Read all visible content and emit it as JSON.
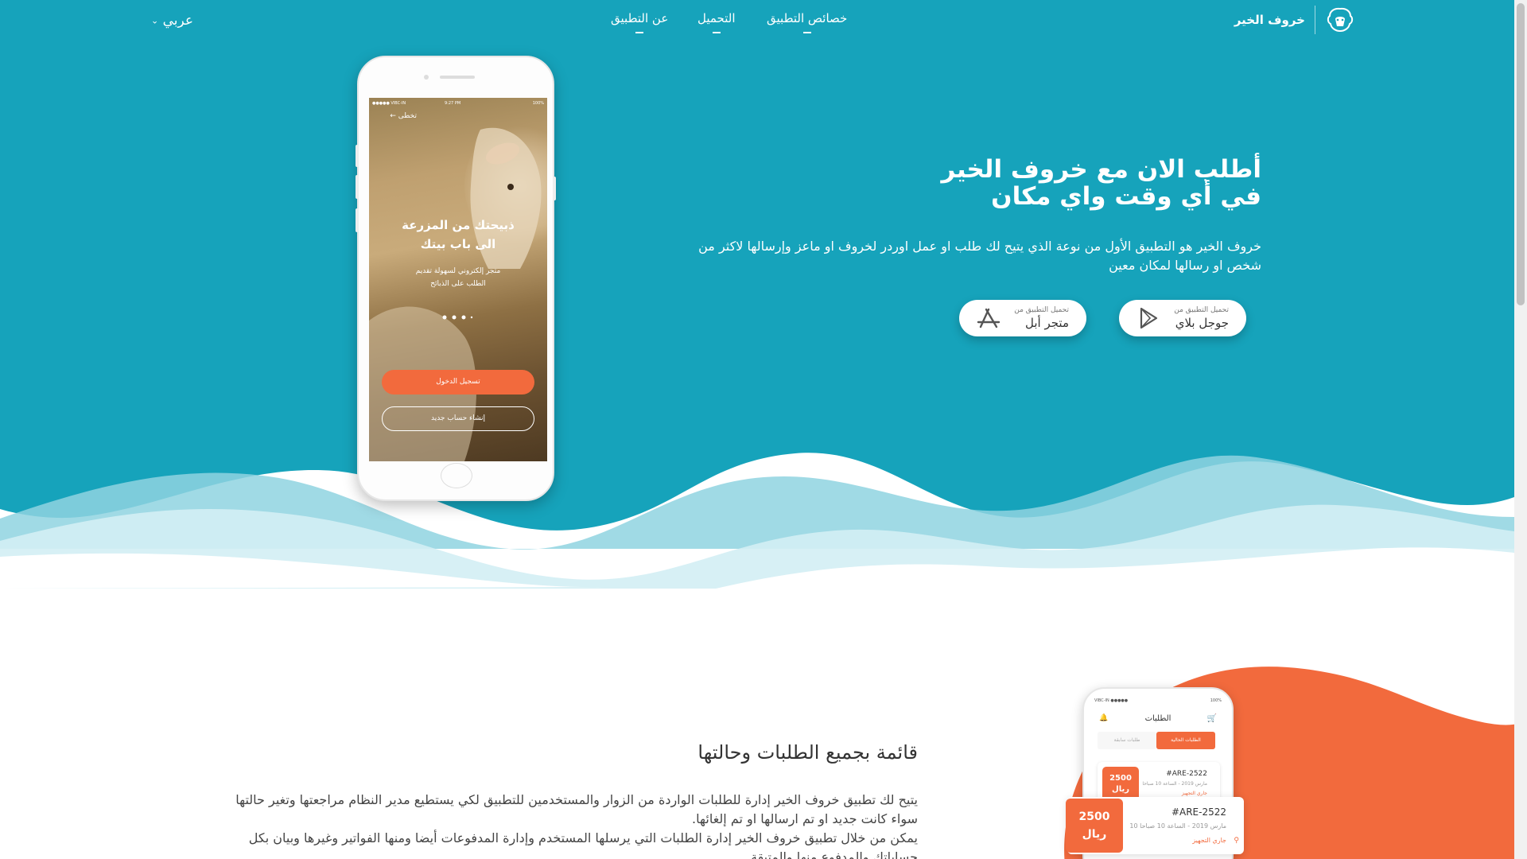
{
  "colors": {
    "teal": "#16a3bb",
    "wave_light": "#8fd3e0",
    "wave_pale": "#d3eef4",
    "orange": "#f26a3d"
  },
  "brand": {
    "name": "خروف الخير",
    "logo_icon": "sheep-logo-icon"
  },
  "nav": {
    "features": "خصائص التطبيق",
    "download": "التحميل",
    "about": "عن التطبيق",
    "language": "عربي",
    "language_icon": "chevron-down-icon"
  },
  "hero": {
    "title_line1": "أطلب الان مع خروف الخير",
    "title_line2": "في أي وقت واي مكان",
    "description": "خروف الخير هو التطبيق الأول من نوعة الذي يتيح لك طلب او عمل اوردر لخروف او ماعز وإرسالها لاكثر من شخص او رسالها لمكان معين",
    "google_play": {
      "small": "تحميل التطبيق من",
      "big": "جوجل بلاي",
      "icon": "google-play-icon"
    },
    "app_store": {
      "small": "تحميل التطبيق من",
      "big": "متجر أبل",
      "icon": "app-store-icon"
    }
  },
  "phone_screen": {
    "status_left": "●●●●● VIBC-IN",
    "status_time": "9:27 PM",
    "status_right": "100%",
    "skip": "تخطى",
    "headline_line1": "ذبيحتك من المزرعة",
    "headline_line2": "الى باب بيتك",
    "sub_line1": "متجر إلكتروني لسهولة تقديم",
    "sub_line2": "الطلب على الذبائح",
    "login_button": "تسجيل الدخول",
    "signup_button": "إنشاء حساب جديد"
  },
  "orders_section": {
    "title": "قائمة بجميع الطلبات وحالتها",
    "desc_line1": "يتيح لك تطبيق خروف الخير إدارة للطلبات الواردة من الزوار والمستخدمين للتطبيق لكي يستطيع مدير النظام مراجعتها وتغير حالتها سواء كانت جديد او تم ارسالها او تم إلغائها.",
    "desc_line2": "يمكن من خلال تطبيق خروف الخير إدارة الطلبات التي يرسلها المستخدم وإدارة المدفوعات أيضا ومنها الفواتير وغيرها وبيان بكل حساباتك والمدفوع منها والمتبقة"
  },
  "orders_phone": {
    "status_left": "●●●●● VIBC-IN",
    "status_right": "100%",
    "title": "الطلبات",
    "tab_active": "الطلبات الحالية",
    "tab_other": "طلبات سابقة",
    "card": {
      "price": "2500",
      "currency": "ريال",
      "id": "#ARE-2522",
      "meta": "مارس 2019 - الساعة 10 صباحا",
      "status": "جاري التجهيز"
    }
  },
  "floating_card": {
    "price": "2500",
    "currency": "ريال",
    "id": "#ARE-2522",
    "meta": "مارس 2019 - الساعة 10 صباحا 10",
    "status": "جاري التجهيز"
  }
}
